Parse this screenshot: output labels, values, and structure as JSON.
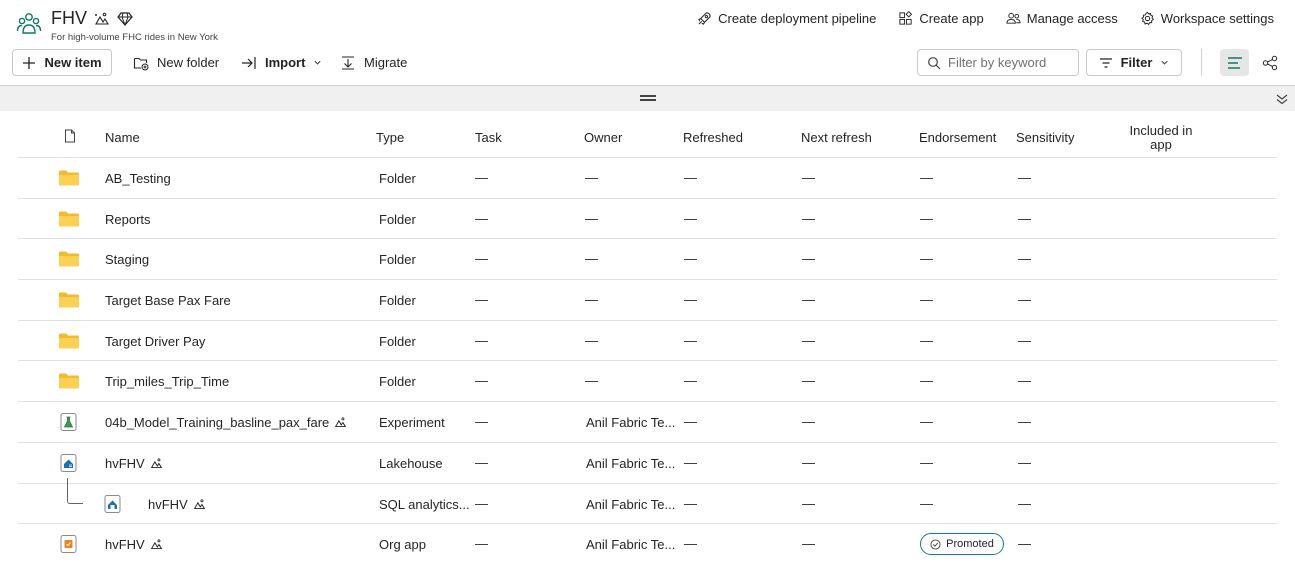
{
  "workspace": {
    "title": "FHV",
    "subtitle": "For high-volume FHC rides in New York"
  },
  "header_actions": [
    {
      "label": "Create deployment pipeline",
      "icon": "rocket-icon"
    },
    {
      "label": "Create app",
      "icon": "app-icon"
    },
    {
      "label": "Manage access",
      "icon": "people-icon"
    },
    {
      "label": "Workspace settings",
      "icon": "gear-icon"
    }
  ],
  "toolbar": {
    "new_item": "New item",
    "new_folder": "New folder",
    "import": "Import",
    "migrate": "Migrate",
    "search_placeholder": "Filter by keyword",
    "filter": "Filter"
  },
  "columns": {
    "name": "Name",
    "type": "Type",
    "task": "Task",
    "owner": "Owner",
    "refreshed": "Refreshed",
    "next_refresh": "Next refresh",
    "endorsement": "Endorsement",
    "sensitivity": "Sensitivity",
    "included_in_app_line1": "Included in",
    "included_in_app_line2": "app"
  },
  "dash": "—",
  "rows": [
    {
      "name": "AB_Testing",
      "type": "Folder",
      "owner": "—",
      "icon": "folder-icon",
      "endorsement": "—"
    },
    {
      "name": "Reports",
      "type": "Folder",
      "owner": "—",
      "icon": "folder-icon",
      "endorsement": "—"
    },
    {
      "name": "Staging",
      "type": "Folder",
      "owner": "—",
      "icon": "folder-icon",
      "endorsement": "—"
    },
    {
      "name": "Target Base Pax Fare",
      "type": "Folder",
      "owner": "—",
      "icon": "folder-icon",
      "endorsement": "—"
    },
    {
      "name": "Target Driver Pay",
      "type": "Folder",
      "owner": "—",
      "icon": "folder-icon",
      "endorsement": "—"
    },
    {
      "name": "Trip_miles_Trip_Time",
      "type": "Folder",
      "owner": "—",
      "icon": "folder-icon",
      "endorsement": "—"
    },
    {
      "name": "04b_Model_Training_basline_pax_fare",
      "type": "Experiment",
      "owner": "Anil Fabric Te...",
      "icon": "experiment-icon",
      "endorsement": "—"
    },
    {
      "name": "hvFHV",
      "type": "Lakehouse",
      "owner": "Anil Fabric Te...",
      "icon": "lakehouse-icon",
      "endorsement": "—"
    },
    {
      "name": "hvFHV",
      "type": "SQL analytics...",
      "owner": "Anil Fabric Te...",
      "icon": "sql-endpoint-icon",
      "endorsement": "—"
    },
    {
      "name": "hvFHV",
      "type": "Org app",
      "owner": "Anil Fabric Te...",
      "icon": "org-app-icon",
      "endorsement": "Promoted"
    }
  ]
}
